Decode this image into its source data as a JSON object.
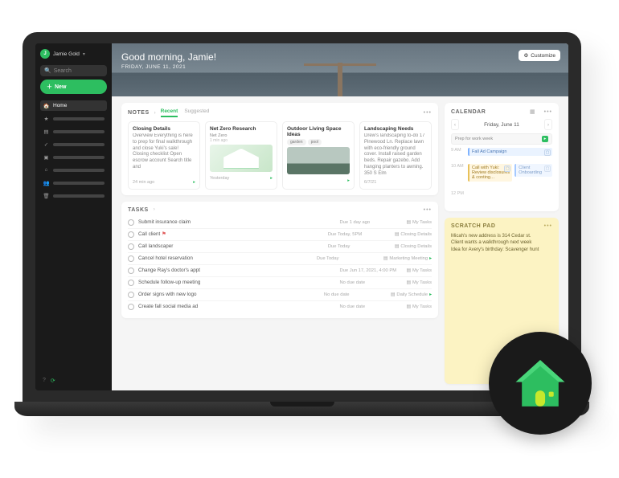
{
  "user": {
    "initial": "J",
    "name": "Jamie Gold"
  },
  "sidebar": {
    "search": "Search",
    "new": "New",
    "items": [
      {
        "label": "Home",
        "icon": "home"
      },
      {
        "label": "",
        "icon": "star"
      },
      {
        "label": "",
        "icon": "note"
      },
      {
        "label": "",
        "icon": "check"
      },
      {
        "label": "",
        "icon": "book"
      },
      {
        "label": "",
        "icon": "tag"
      },
      {
        "label": "",
        "icon": "share"
      },
      {
        "label": "",
        "icon": "trash"
      }
    ]
  },
  "hero": {
    "greeting": "Good morning, Jamie!",
    "date": "FRIDAY, JUNE 11, 2021",
    "customize": "Customize"
  },
  "notes": {
    "title": "NOTES",
    "tabs": [
      "Recent",
      "Suggested"
    ],
    "cards": [
      {
        "title": "Closing Details",
        "body": "Overview Everything is here to prep for final walkthrough and close Yuki's sale! Closing checklist Open escrow account Search title and",
        "meta": "24 min ago"
      },
      {
        "title": "Net Zero Research",
        "sub": "Net Zero",
        "meta": "1 min ago",
        "meta2": "Yesterday"
      },
      {
        "title": "Outdoor Living Space Ideas",
        "pills": [
          "garden",
          "pool"
        ]
      },
      {
        "title": "Landscaping Needs",
        "body": "Drew's landscaping to-do 17 Pinewood Ln. Replace lawn with eco-friendly ground cover. Install raised garden beds. Repair gazebo. Add hanging planters to awning. 350 S Elm",
        "meta": "6/7/21"
      }
    ]
  },
  "tasks": {
    "title": "TASKS",
    "rows": [
      {
        "name": "Submit insurance claim",
        "due": "Due 1 day ago",
        "list": "My Tasks"
      },
      {
        "name": "Call client",
        "flag": true,
        "due": "Due Today, 5PM",
        "list": "Closing Details"
      },
      {
        "name": "Call landscaper",
        "due": "Due Today",
        "list": "Closing Details"
      },
      {
        "name": "Cancel hotel reservation",
        "due": "Due Today",
        "list": "Marketing Meeting",
        "green": true
      },
      {
        "name": "Change Ray's doctor's appt",
        "due": "Due Jun 17, 2021, 4:00 PM",
        "list": "My Tasks"
      },
      {
        "name": "Schedule follow-up meeting",
        "due": "No due date",
        "list": "My Tasks"
      },
      {
        "name": "Order signs with new logo",
        "due": "No due date",
        "list": "Daily Schedule",
        "green": true
      },
      {
        "name": "Create fall social media ad",
        "due": "No due date",
        "list": "My Tasks"
      }
    ]
  },
  "calendar": {
    "title": "CALENDAR",
    "date": "Friday, June 11",
    "allday": "Prep for work week",
    "events": [
      {
        "time": "9 AM",
        "title": "Fall Ad Campaign"
      },
      {
        "time": "10 AM",
        "title": "Call with Yuki: Review disclosures & conting…",
        "kind": "y",
        "title2": "Client Onboarding"
      },
      {
        "time": "12 PM",
        "title": ""
      }
    ]
  },
  "scratch": {
    "title": "SCRATCH PAD",
    "text": "Micah's new address is 314 Cedar st.\nClient wants a walkthrough next week\nIdea for Avery's birthday: Scavenger hunt"
  }
}
